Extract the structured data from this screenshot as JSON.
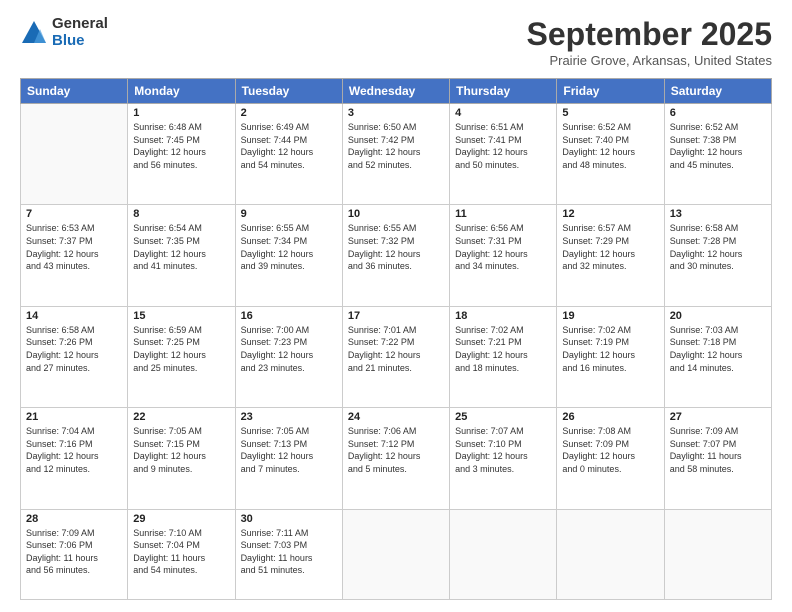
{
  "logo": {
    "general": "General",
    "blue": "Blue"
  },
  "header": {
    "month": "September 2025",
    "location": "Prairie Grove, Arkansas, United States"
  },
  "days_of_week": [
    "Sunday",
    "Monday",
    "Tuesday",
    "Wednesday",
    "Thursday",
    "Friday",
    "Saturday"
  ],
  "weeks": [
    [
      {
        "day": "",
        "info": ""
      },
      {
        "day": "1",
        "info": "Sunrise: 6:48 AM\nSunset: 7:45 PM\nDaylight: 12 hours\nand 56 minutes."
      },
      {
        "day": "2",
        "info": "Sunrise: 6:49 AM\nSunset: 7:44 PM\nDaylight: 12 hours\nand 54 minutes."
      },
      {
        "day": "3",
        "info": "Sunrise: 6:50 AM\nSunset: 7:42 PM\nDaylight: 12 hours\nand 52 minutes."
      },
      {
        "day": "4",
        "info": "Sunrise: 6:51 AM\nSunset: 7:41 PM\nDaylight: 12 hours\nand 50 minutes."
      },
      {
        "day": "5",
        "info": "Sunrise: 6:52 AM\nSunset: 7:40 PM\nDaylight: 12 hours\nand 48 minutes."
      },
      {
        "day": "6",
        "info": "Sunrise: 6:52 AM\nSunset: 7:38 PM\nDaylight: 12 hours\nand 45 minutes."
      }
    ],
    [
      {
        "day": "7",
        "info": "Sunrise: 6:53 AM\nSunset: 7:37 PM\nDaylight: 12 hours\nand 43 minutes."
      },
      {
        "day": "8",
        "info": "Sunrise: 6:54 AM\nSunset: 7:35 PM\nDaylight: 12 hours\nand 41 minutes."
      },
      {
        "day": "9",
        "info": "Sunrise: 6:55 AM\nSunset: 7:34 PM\nDaylight: 12 hours\nand 39 minutes."
      },
      {
        "day": "10",
        "info": "Sunrise: 6:55 AM\nSunset: 7:32 PM\nDaylight: 12 hours\nand 36 minutes."
      },
      {
        "day": "11",
        "info": "Sunrise: 6:56 AM\nSunset: 7:31 PM\nDaylight: 12 hours\nand 34 minutes."
      },
      {
        "day": "12",
        "info": "Sunrise: 6:57 AM\nSunset: 7:29 PM\nDaylight: 12 hours\nand 32 minutes."
      },
      {
        "day": "13",
        "info": "Sunrise: 6:58 AM\nSunset: 7:28 PM\nDaylight: 12 hours\nand 30 minutes."
      }
    ],
    [
      {
        "day": "14",
        "info": "Sunrise: 6:58 AM\nSunset: 7:26 PM\nDaylight: 12 hours\nand 27 minutes."
      },
      {
        "day": "15",
        "info": "Sunrise: 6:59 AM\nSunset: 7:25 PM\nDaylight: 12 hours\nand 25 minutes."
      },
      {
        "day": "16",
        "info": "Sunrise: 7:00 AM\nSunset: 7:23 PM\nDaylight: 12 hours\nand 23 minutes."
      },
      {
        "day": "17",
        "info": "Sunrise: 7:01 AM\nSunset: 7:22 PM\nDaylight: 12 hours\nand 21 minutes."
      },
      {
        "day": "18",
        "info": "Sunrise: 7:02 AM\nSunset: 7:21 PM\nDaylight: 12 hours\nand 18 minutes."
      },
      {
        "day": "19",
        "info": "Sunrise: 7:02 AM\nSunset: 7:19 PM\nDaylight: 12 hours\nand 16 minutes."
      },
      {
        "day": "20",
        "info": "Sunrise: 7:03 AM\nSunset: 7:18 PM\nDaylight: 12 hours\nand 14 minutes."
      }
    ],
    [
      {
        "day": "21",
        "info": "Sunrise: 7:04 AM\nSunset: 7:16 PM\nDaylight: 12 hours\nand 12 minutes."
      },
      {
        "day": "22",
        "info": "Sunrise: 7:05 AM\nSunset: 7:15 PM\nDaylight: 12 hours\nand 9 minutes."
      },
      {
        "day": "23",
        "info": "Sunrise: 7:05 AM\nSunset: 7:13 PM\nDaylight: 12 hours\nand 7 minutes."
      },
      {
        "day": "24",
        "info": "Sunrise: 7:06 AM\nSunset: 7:12 PM\nDaylight: 12 hours\nand 5 minutes."
      },
      {
        "day": "25",
        "info": "Sunrise: 7:07 AM\nSunset: 7:10 PM\nDaylight: 12 hours\nand 3 minutes."
      },
      {
        "day": "26",
        "info": "Sunrise: 7:08 AM\nSunset: 7:09 PM\nDaylight: 12 hours\nand 0 minutes."
      },
      {
        "day": "27",
        "info": "Sunrise: 7:09 AM\nSunset: 7:07 PM\nDaylight: 11 hours\nand 58 minutes."
      }
    ],
    [
      {
        "day": "28",
        "info": "Sunrise: 7:09 AM\nSunset: 7:06 PM\nDaylight: 11 hours\nand 56 minutes."
      },
      {
        "day": "29",
        "info": "Sunrise: 7:10 AM\nSunset: 7:04 PM\nDaylight: 11 hours\nand 54 minutes."
      },
      {
        "day": "30",
        "info": "Sunrise: 7:11 AM\nSunset: 7:03 PM\nDaylight: 11 hours\nand 51 minutes."
      },
      {
        "day": "",
        "info": ""
      },
      {
        "day": "",
        "info": ""
      },
      {
        "day": "",
        "info": ""
      },
      {
        "day": "",
        "info": ""
      }
    ]
  ]
}
